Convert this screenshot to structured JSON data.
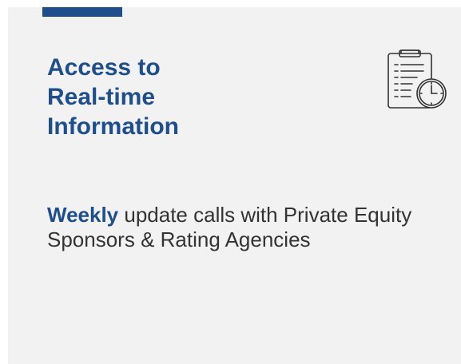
{
  "card": {
    "title_lines": [
      "Access to",
      "Real-time",
      "Information"
    ],
    "icon": "clipboard-clock-icon",
    "body": {
      "highlight": "Weekly",
      "text": " update calls with Private Equity Sponsors & Rating Agencies"
    }
  },
  "colors": {
    "accent": "#1f4e8c",
    "card_background": "#f2f2f2",
    "body_text": "#333333"
  }
}
